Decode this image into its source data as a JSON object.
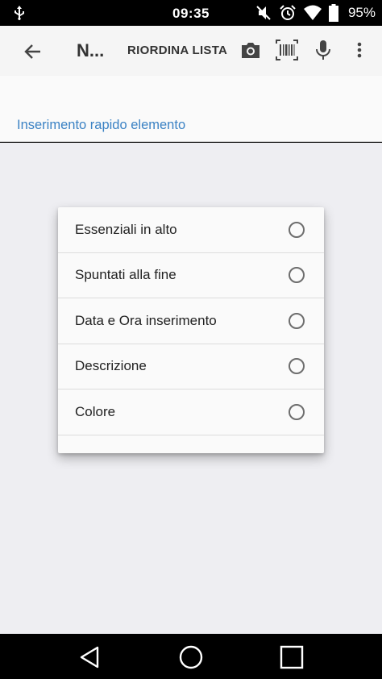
{
  "status_bar": {
    "time": "09:35",
    "battery_text": "95%",
    "icons": [
      "usb-icon",
      "mute-icon",
      "alarm-icon",
      "wifi-icon",
      "battery-icon"
    ]
  },
  "toolbar": {
    "title": "N...",
    "reorder_label": "RIORDINA LISTA",
    "icons": [
      "back-arrow-icon",
      "camera-icon",
      "barcode-icon",
      "microphone-icon",
      "overflow-menu-icon"
    ]
  },
  "quick_entry": {
    "label": "Inserimento rapido elemento"
  },
  "dialog": {
    "options": [
      {
        "label": "Essenziali in alto",
        "selected": false
      },
      {
        "label": "Spuntati alla fine",
        "selected": false
      },
      {
        "label": "Data e Ora inserimento",
        "selected": false
      },
      {
        "label": "Descrizione",
        "selected": false
      },
      {
        "label": "Colore",
        "selected": false
      }
    ]
  },
  "nav_bar": {
    "icons": [
      "back-triangle-icon",
      "home-circle-icon",
      "recents-square-icon"
    ]
  },
  "colors": {
    "accent": "#3b82c4",
    "toolbar_bg": "#f5f5f5",
    "content_bg": "#eeeef2"
  }
}
